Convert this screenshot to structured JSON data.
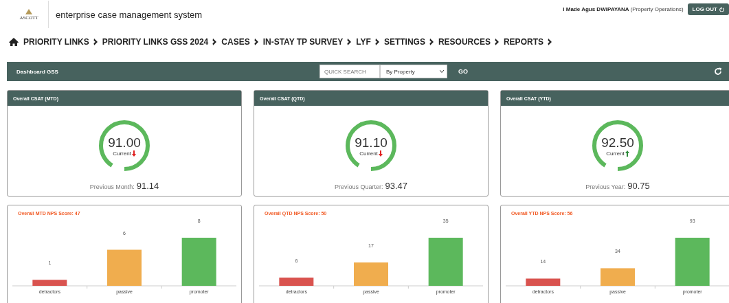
{
  "header": {
    "logo_text": "ASCOTT",
    "app_title": "enterprise case management system",
    "user_name": "I Made Agus DWIPAYANA",
    "user_role": "(Property Operations)",
    "logout_label": "LOG OUT"
  },
  "nav": [
    {
      "label": "PRIORITY LINKS"
    },
    {
      "label": "PRIORITY LINKS GSS 2024"
    },
    {
      "label": "CASES"
    },
    {
      "label": "IN-STAY TP SURVEY"
    },
    {
      "label": "LYF"
    },
    {
      "label": "SETTINGS"
    },
    {
      "label": "RESOURCES"
    },
    {
      "label": "REPORTS"
    }
  ],
  "toolbar": {
    "title": "Dashboard GSS",
    "search_placeholder": "QUICK SEARCH",
    "filter_value": "By Property",
    "go_label": "GO"
  },
  "csat": [
    {
      "title": "Overall CSAT (MTD)",
      "value": "91.00",
      "current_label": "Current",
      "trend_up": false,
      "previous_label": "Previous Month:",
      "previous_value": "91.14"
    },
    {
      "title": "Overall CSAT (QTD)",
      "value": "91.10",
      "current_label": "Current",
      "trend_up": false,
      "previous_label": "Previous Quarter:",
      "previous_value": "93.47"
    },
    {
      "title": "Overall CSAT (YTD)",
      "value": "92.50",
      "current_label": "Current",
      "trend_up": true,
      "previous_label": "Previous Year:",
      "previous_value": "90.75"
    }
  ],
  "nps": [
    {
      "title": "Overall MTD NPS Score: 47",
      "chart_data": {
        "type": "bar",
        "categories": [
          "detractors",
          "passive",
          "promoter"
        ],
        "values": [
          1,
          6,
          8
        ],
        "colors": [
          "#d9534f",
          "#f0ad4e",
          "#5cb85c"
        ],
        "data_labels": true
      }
    },
    {
      "title": "Overall QTD NPS Score: 50",
      "chart_data": {
        "type": "bar",
        "categories": [
          "detractors",
          "passive",
          "promoter"
        ],
        "values": [
          6,
          17,
          35
        ],
        "colors": [
          "#d9534f",
          "#f0ad4e",
          "#5cb85c"
        ],
        "data_labels": true
      }
    },
    {
      "title": "Overall YTD NPS Score: 56",
      "chart_data": {
        "type": "bar",
        "categories": [
          "detractors",
          "passive",
          "promoter"
        ],
        "values": [
          14,
          34,
          93
        ],
        "colors": [
          "#d9534f",
          "#f0ad4e",
          "#5cb85c"
        ],
        "data_labels": true
      }
    }
  ]
}
